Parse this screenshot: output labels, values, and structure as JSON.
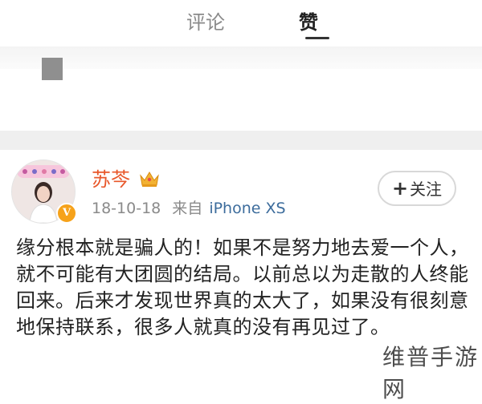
{
  "tabs": [
    {
      "label": "评论",
      "active": false
    },
    {
      "label": "赞",
      "active": true
    }
  ],
  "post": {
    "username": "苏芩",
    "avatar_icon": "avatar-image",
    "badge_icon": "crown-icon",
    "verified_icon": "vip-v-icon",
    "verified_mark": "V",
    "date": "18-10-18",
    "source_prefix": "来自",
    "device": "iPhone XS",
    "follow_label": "关注",
    "follow_plus": "+",
    "content": "缘分根本就是骗人的！如果不是努力地去爱一个人，就不可能有大团圆的结局。以前总以为走散的人终能回来。后来才发现世界真的太大了，如果没有很刻意地保持联系，很多人就真的没有再见过了。"
  },
  "watermark": "维普手游网",
  "colors": {
    "username": "#e8572a",
    "device": "#3c6c9c",
    "muted": "#8a8a8a",
    "badge": "#f6a21a"
  }
}
